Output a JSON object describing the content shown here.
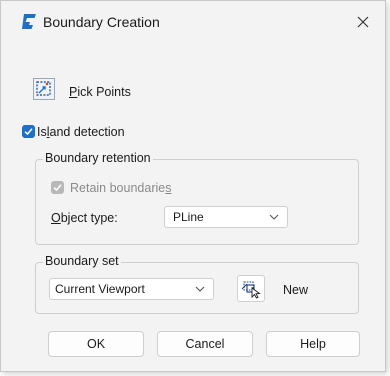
{
  "window": {
    "title": "Boundary Creation",
    "app_icon": "g-logo-icon",
    "close_icon": "close-icon",
    "accent_color": "#1f6fc5"
  },
  "pick_points": {
    "icon": "pick-points-icon",
    "mnemonic": "P",
    "label_rest": "ick Points"
  },
  "island_detection": {
    "checked": true,
    "label_pre": "Is",
    "mnemonic": "l",
    "label_post": "and detection"
  },
  "boundary_retention": {
    "title": "Boundary retention",
    "retain": {
      "checked": true,
      "disabled": true,
      "label_pre": "Retain boundarie",
      "mnemonic": "s"
    },
    "object_type": {
      "mnemonic": "O",
      "label_post": "bject type:",
      "value": "PLine"
    }
  },
  "boundary_set": {
    "title": "Boundary set",
    "value": "Current Viewport",
    "new_icon": "select-objects-icon",
    "new_label": "New"
  },
  "buttons": {
    "ok": "OK",
    "cancel": "Cancel",
    "help": "Help"
  }
}
